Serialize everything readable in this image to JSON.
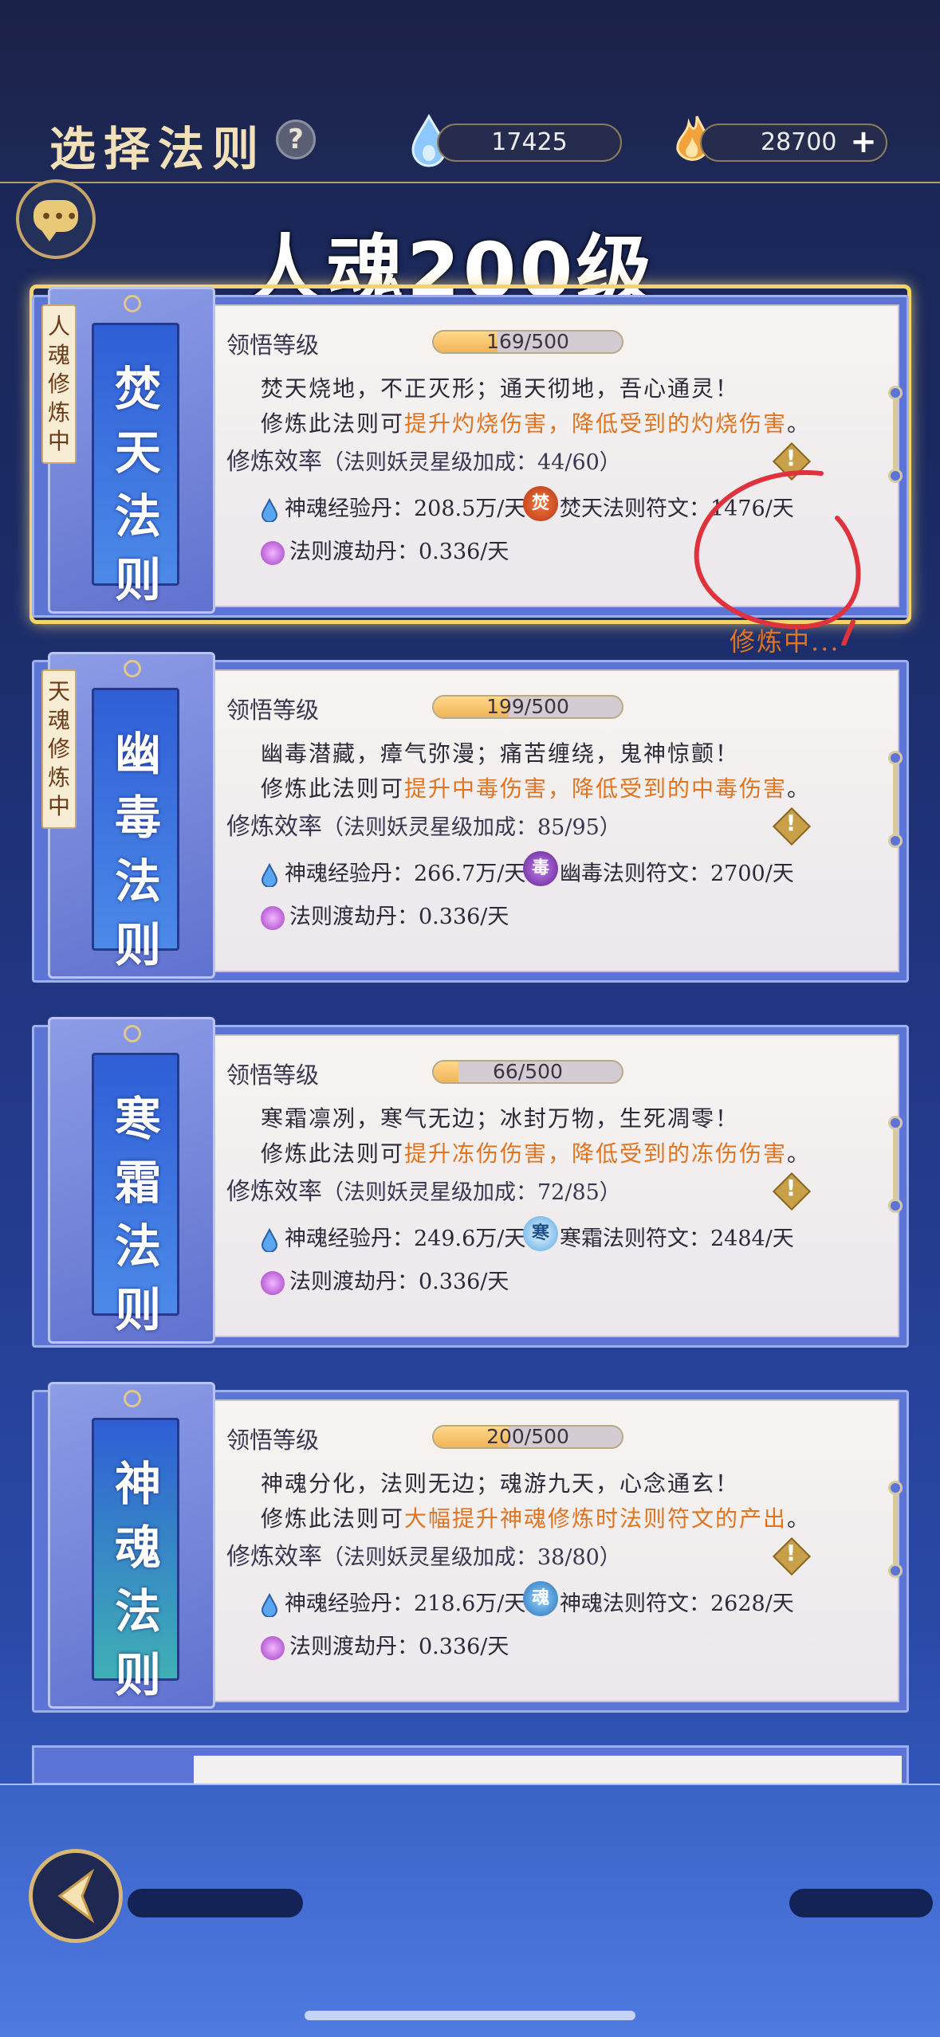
{
  "header": {
    "title": "选择法则",
    "help_icon": "?",
    "currency": [
      {
        "icon": "water-drop-icon",
        "value": "17425"
      },
      {
        "icon": "flame-icon",
        "value": "28700",
        "plus": "+"
      }
    ]
  },
  "overlay_text": "人魂200级",
  "cards": [
    {
      "tag": "人魂修炼中",
      "name": "焚天法则",
      "level_label": "领悟等级",
      "level": "169/500",
      "level_fraction": 0.338,
      "desc1": "焚天烧地，不正灭形；通天彻地，吾心通灵！",
      "desc2_pre": "修炼此法则可",
      "desc2_hl": "提升灼烧伤害，降低受到的灼烧伤害",
      "desc2_post": "。",
      "eff_label": "修炼效率",
      "eff_bonus": "（法则妖灵星级加成：44/60）",
      "stat1": "神魂经验丹：208.5万/天",
      "rune_char": "焚",
      "stat2": "焚天法则符文：1476/天",
      "stat3": "法则渡劫丹：0.336/天",
      "status": "修炼中..."
    },
    {
      "tag": "天魂修炼中",
      "name": "幽毒法则",
      "level_label": "领悟等级",
      "level": "199/500",
      "level_fraction": 0.398,
      "desc1": "幽毒潜藏，瘴气弥漫；痛苦缠绕，鬼神惊颤！",
      "desc2_pre": "修炼此法则可",
      "desc2_hl": "提升中毒伤害，降低受到的中毒伤害",
      "desc2_post": "。",
      "eff_label": "修炼效率",
      "eff_bonus": "（法则妖灵星级加成：85/95）",
      "stat1": "神魂经验丹：266.7万/天",
      "rune_char": "毒",
      "stat2": "幽毒法则符文：2700/天",
      "stat3": "法则渡劫丹：0.336/天"
    },
    {
      "tag": "",
      "name": "寒霜法则",
      "level_label": "领悟等级",
      "level": "66/500",
      "level_fraction": 0.132,
      "desc1": "寒霜凛冽，寒气无边；冰封万物，生死凋零！",
      "desc2_pre": "修炼此法则可",
      "desc2_hl": "提升冻伤伤害，降低受到的冻伤伤害",
      "desc2_post": "。",
      "eff_label": "修炼效率",
      "eff_bonus": "（法则妖灵星级加成：72/85）",
      "stat1": "神魂经验丹：249.6万/天",
      "rune_char": "寒",
      "stat2": "寒霜法则符文：2484/天",
      "stat3": "法则渡劫丹：0.336/天"
    },
    {
      "tag": "",
      "name": "神魂法则",
      "level_label": "领悟等级",
      "level": "200/500",
      "level_fraction": 0.4,
      "desc1": "神魂分化，法则无边；魂游九天，心念通玄！",
      "desc2_pre": "修炼此法则可",
      "desc2_hl": "大幅提升神魂修炼时法则符文的产出",
      "desc2_post": "。",
      "eff_label": "修炼效率",
      "eff_bonus": "（法则妖灵星级加成：38/80）",
      "stat1": "神魂经验丹：218.6万/天",
      "rune_char": "魂",
      "stat2": "神魂法则符文：2628/天",
      "stat3": "法则渡劫丹：0.336/天"
    }
  ],
  "colors": {
    "highlight": "#e07421",
    "accent_gold": "#f1d46c",
    "annotation": "#e0323c"
  }
}
